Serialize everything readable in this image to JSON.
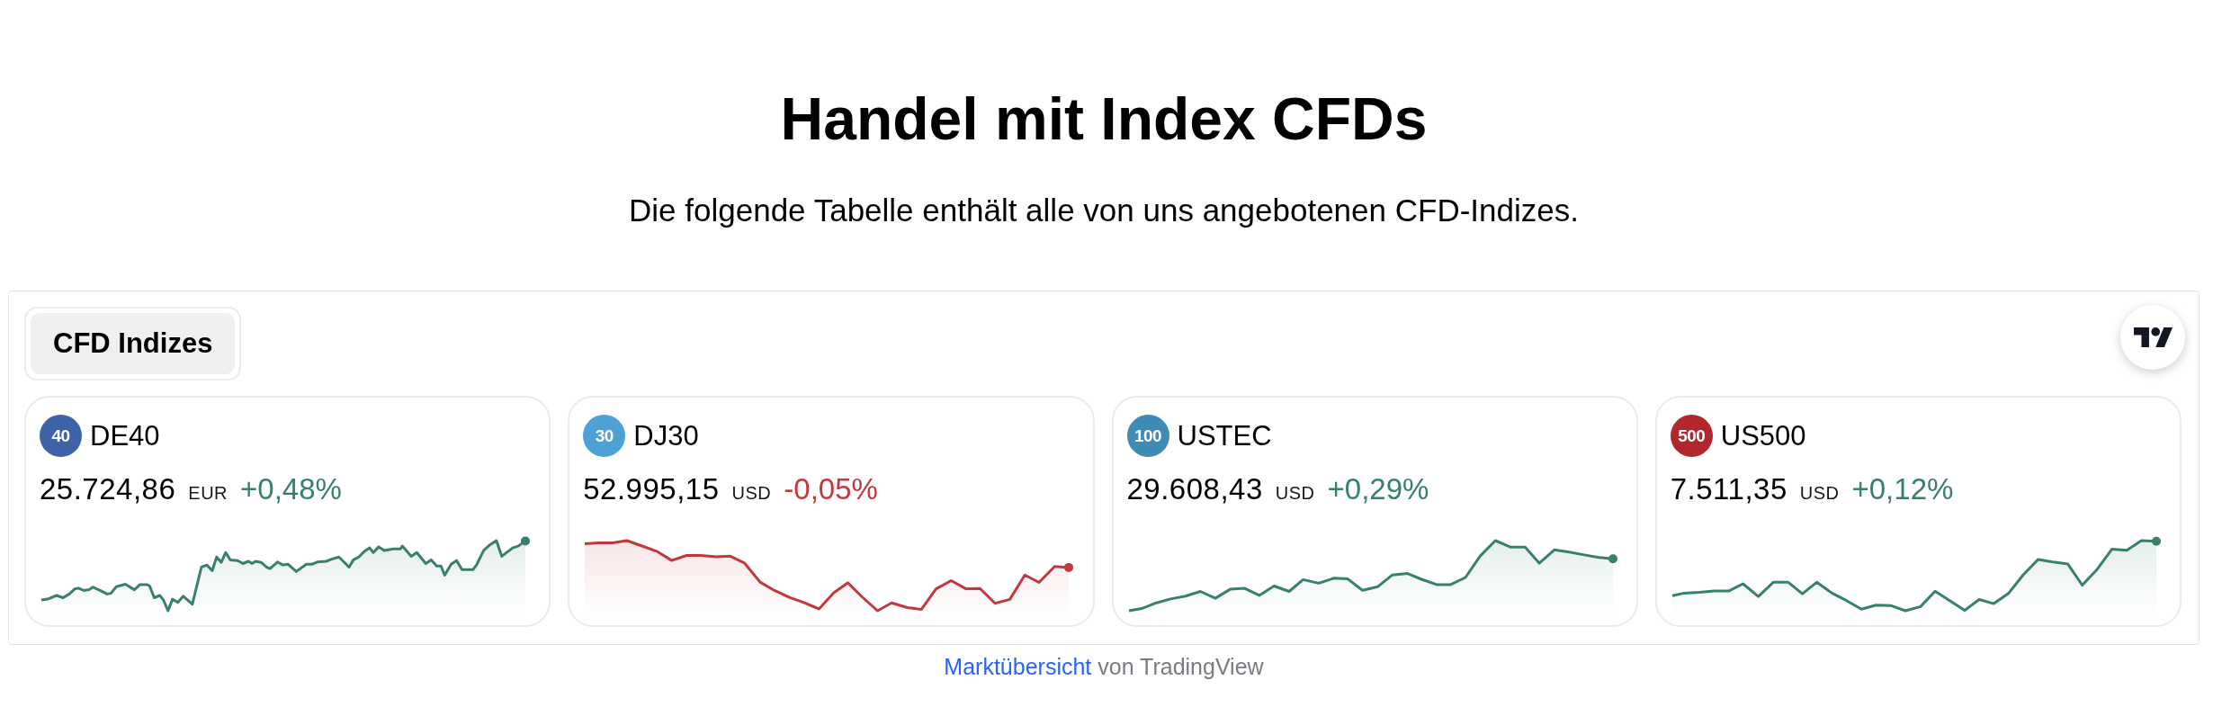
{
  "heading": {
    "title": "Handel mit Index CFDs",
    "subtitle": "Die folgende Tabelle enthält alle von uns angebotenen CFD-Indizes."
  },
  "widget": {
    "tabs": [
      {
        "label": "CFD Indizes",
        "selected": true
      }
    ],
    "quotes": [
      {
        "badge": "40",
        "color": "#3d63a6",
        "symbol": "DE40",
        "price": "25.724,86",
        "currency": "EUR",
        "change": "+0,48%",
        "rising": true
      },
      {
        "badge": "30",
        "color": "#4ea1d5",
        "symbol": "DJ30",
        "price": "52.995,15",
        "currency": "USD",
        "change": "-0,05%",
        "rising": false
      },
      {
        "badge": "100",
        "color": "#3e8bb5",
        "symbol": "USTEC",
        "price": "29.608,43",
        "currency": "USD",
        "change": "+0,29%",
        "rising": true
      },
      {
        "badge": "500",
        "color": "#b2262e",
        "symbol": "US500",
        "price": "7.511,35",
        "currency": "USD",
        "change": "+0,12%",
        "rising": true
      }
    ]
  },
  "footer": {
    "link": "Marktübersicht",
    "text": "von TradingView"
  }
}
